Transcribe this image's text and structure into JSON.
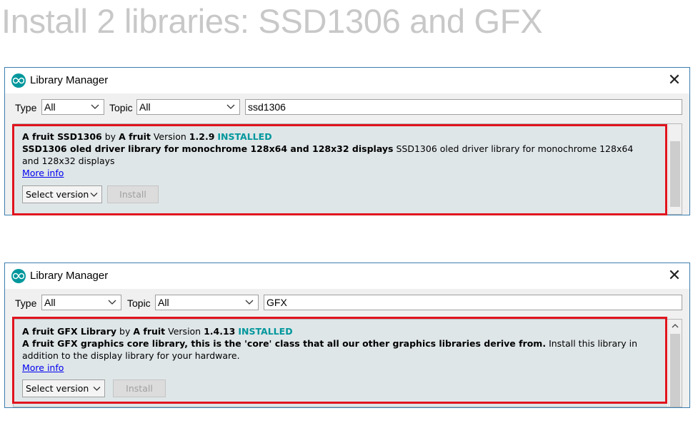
{
  "heading": "Install 2 libraries: SSD1306 and GFX",
  "colors": {
    "accent": "#00979c",
    "highlight": "#e0141e",
    "link": "#0000ee",
    "heading": "#c8c8c8"
  },
  "windows": [
    {
      "title": "Library Manager",
      "close_label": "✕",
      "type_label": "Type",
      "type_value": "All",
      "topic_label": "Topic",
      "topic_value": "All",
      "search_value": "ssd1306",
      "library": {
        "name": "A fruit SSD1306",
        "by_label": "by",
        "author": "A fruit",
        "version_label": "Version",
        "version": "1.2.9",
        "status": "INSTALLED",
        "summary": "SSD1306 oled driver library for monochrome 128x64 and 128x32 displays",
        "description": "SSD1306 oled driver library for monochrome 128x64 and 128x32 displays",
        "more_info": "More info",
        "select_version": "Select version",
        "install": "Install"
      }
    },
    {
      "title": "Library Manager",
      "close_label": "✕",
      "type_label": "Type",
      "type_value": "All",
      "topic_label": "Topic",
      "topic_value": "All",
      "search_value": "GFX",
      "library": {
        "name": "A fruit GFX Library",
        "by_label": "by",
        "author": "A fruit",
        "version_label": "Version",
        "version": "1.4.13",
        "status": "INSTALLED",
        "summary": "A fruit GFX graphics core library, this is the 'core' class that all our other graphics libraries derive from.",
        "description": "Install this library in addition to the display library for your hardware.",
        "more_info": "More info",
        "select_version": "Select version",
        "install": "Install"
      }
    }
  ]
}
